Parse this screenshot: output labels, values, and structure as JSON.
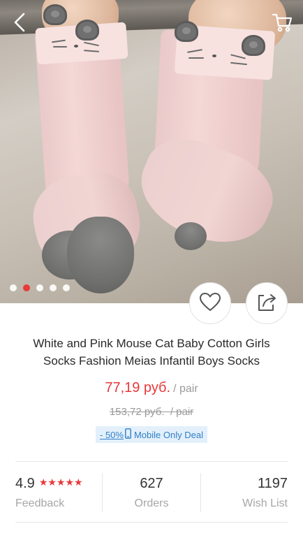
{
  "header": {
    "back_icon": "chevron-left-icon",
    "cart_icon": "cart-icon"
  },
  "gallery": {
    "image_count": 5,
    "active_index": 1,
    "wishlist_icon": "heart-icon",
    "share_icon": "share-icon"
  },
  "product": {
    "title": "White and Pink Mouse Cat Baby Cotton Girls Socks Fashion Meias Infantil Boys Socks",
    "price": "77,19 руб.",
    "price_unit": "/ pair",
    "old_price": "153,72 руб.",
    "old_price_unit": "/ pair",
    "discount": "- 50%",
    "deal_label": "Mobile Only Deal"
  },
  "stats": {
    "rating": "4.9",
    "stars": "★★★★★",
    "rating_label": "Feedback",
    "orders": "627",
    "orders_label": "Orders",
    "wishlist": "1197",
    "wishlist_label": "Wish List"
  },
  "colors": {
    "accent_red": "#e8393b",
    "deal_blue": "#2f7fc8",
    "deal_bg": "#e3f0fb"
  }
}
